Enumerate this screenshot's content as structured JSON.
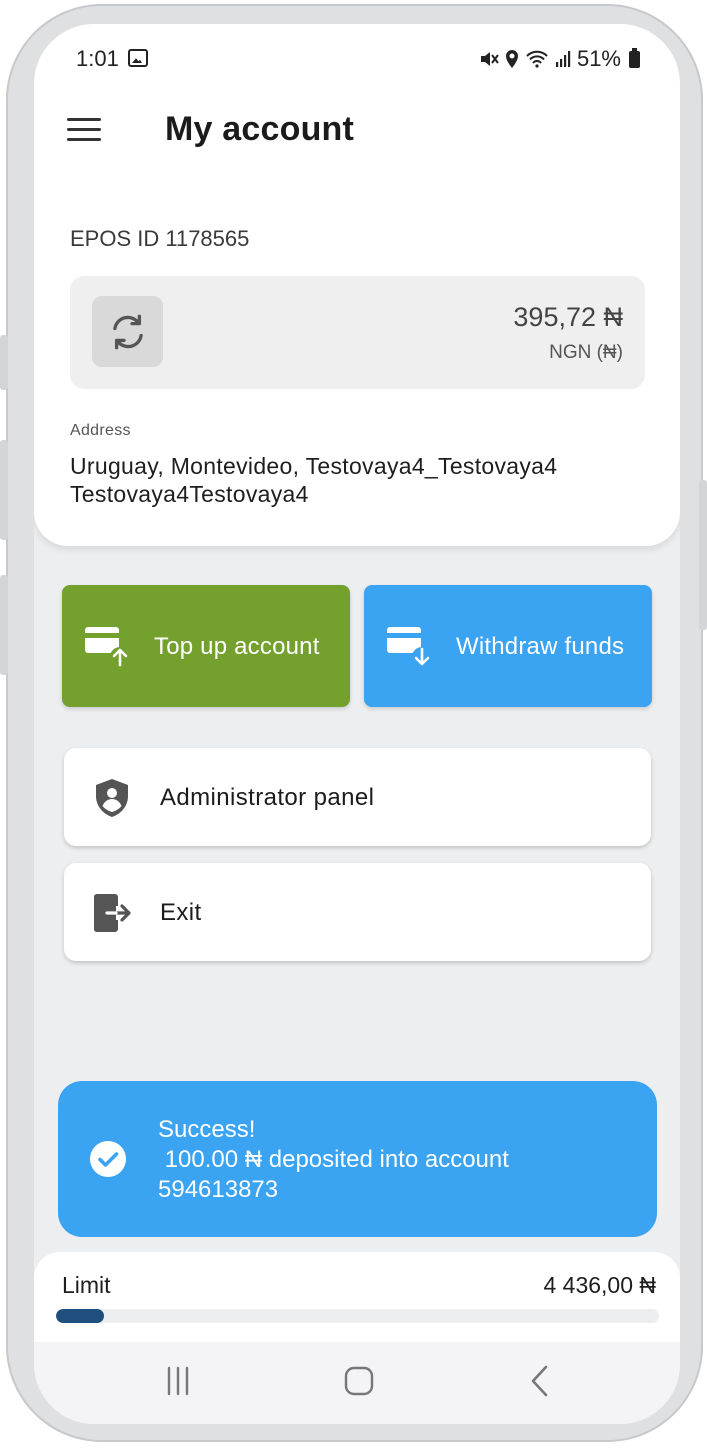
{
  "status_bar": {
    "time": "1:01",
    "battery": "51%"
  },
  "header": {
    "title": "My account"
  },
  "account": {
    "epos_id": "EPOS ID 1178565",
    "balance": "395,72 ₦",
    "currency": "NGN (₦)",
    "address_label": "Address",
    "address_value": "Uruguay, Montevideo, Testovaya4_Testovaya4 Testovaya4Testovaya4"
  },
  "actions": {
    "top_up_label": "Top up account",
    "withdraw_label": "Withdraw funds"
  },
  "menu": {
    "admin_label": "Administrator panel",
    "exit_label": "Exit"
  },
  "toast": {
    "text": "Success!\n 100.00 ₦ deposited into account\n594613873"
  },
  "limit": {
    "label": "Limit",
    "value": "4 436,00 ₦",
    "fill_fraction": 0.08
  },
  "colors": {
    "top_up": "#74a02d",
    "withdraw": "#3aa3f2",
    "toast": "#3aa3f2",
    "limit_fill": "#1f4f7f"
  }
}
